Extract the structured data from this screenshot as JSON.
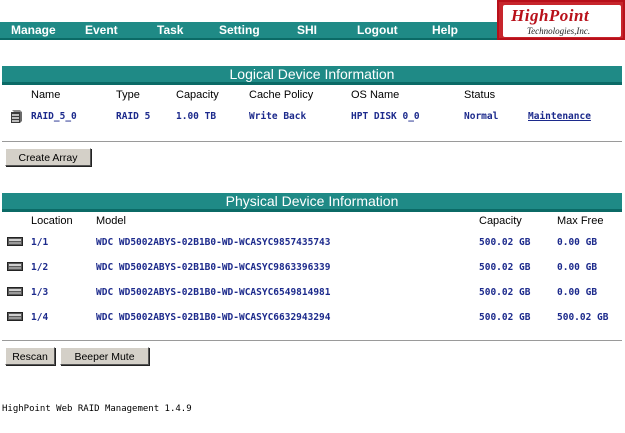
{
  "nav": {
    "items": [
      "Manage",
      "Event",
      "Task",
      "Setting",
      "SHI",
      "Logout",
      "Help"
    ]
  },
  "logo": {
    "title": "HighPoint",
    "subtitle": "Technologies,Inc."
  },
  "logical": {
    "title": "Logical Device Information",
    "headers": [
      "Name",
      "Type",
      "Capacity",
      "Cache Policy",
      "OS Name",
      "Status"
    ],
    "row": {
      "name": "RAID_5_0",
      "type": "RAID 5",
      "capacity": "1.00 TB",
      "cache_policy": "Write Back",
      "os_name": "HPT DISK 0_0",
      "status": "Normal",
      "action": "Maintenance"
    }
  },
  "create_array_label": "Create Array",
  "physical": {
    "title": "Physical Device Information",
    "headers": {
      "location": "Location",
      "model": "Model",
      "capacity": "Capacity",
      "max_free": "Max Free"
    },
    "rows": [
      {
        "location": "1/1",
        "model": "WDC WD5002ABYS-02B1B0-WD-WCASYC9857435743",
        "capacity": "500.02 GB",
        "max_free": "0.00 GB"
      },
      {
        "location": "1/2",
        "model": "WDC WD5002ABYS-02B1B0-WD-WCASYC9863396339",
        "capacity": "500.02 GB",
        "max_free": "0.00 GB"
      },
      {
        "location": "1/3",
        "model": "WDC WD5002ABYS-02B1B0-WD-WCASYC6549814981",
        "capacity": "500.02 GB",
        "max_free": "0.00 GB"
      },
      {
        "location": "1/4",
        "model": "WDC WD5002ABYS-02B1B0-WD-WCASYC6632943294",
        "capacity": "500.02 GB",
        "max_free": "500.02 GB"
      }
    ]
  },
  "buttons": {
    "rescan": "Rescan",
    "beeper_mute": "Beeper Mute"
  },
  "footer": {
    "version": "HighPoint Web RAID Management 1.4.9"
  },
  "colors": {
    "nav_bg": "#1f8a86",
    "value_text": "#1c2a8c",
    "logo_bg": "#c7252c"
  }
}
